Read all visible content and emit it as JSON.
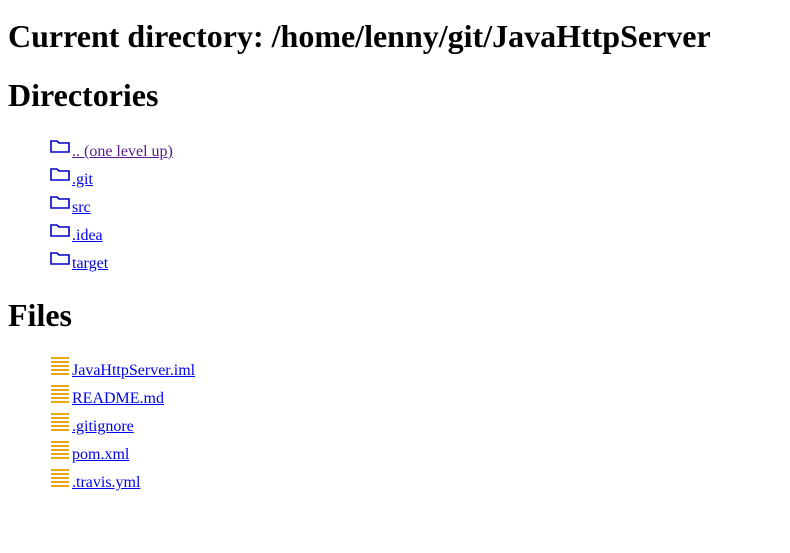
{
  "page": {
    "title": "Current directory: /home/lenny/git/JavaHttpServer",
    "directories_heading": "Directories",
    "files_heading": "Files"
  },
  "directories": [
    {
      "label": ".. (one level up)",
      "visited": true,
      "icon": "folder-icon"
    },
    {
      "label": ".git",
      "visited": false,
      "icon": "folder-icon"
    },
    {
      "label": "src",
      "visited": false,
      "icon": "folder-icon"
    },
    {
      "label": ".idea",
      "visited": false,
      "icon": "folder-icon"
    },
    {
      "label": "target",
      "visited": false,
      "icon": "folder-icon"
    }
  ],
  "files": [
    {
      "label": "JavaHttpServer.iml",
      "icon": "file-icon"
    },
    {
      "label": "README.md",
      "icon": "file-icon"
    },
    {
      "label": ".gitignore",
      "icon": "file-icon"
    },
    {
      "label": "pom.xml",
      "icon": "file-icon"
    },
    {
      "label": ".travis.yml",
      "icon": "file-icon"
    }
  ],
  "colors": {
    "link": "#0000ee",
    "visited_link": "#551a8b",
    "folder_icon": "#0000cc",
    "file_icon": "#e6a817"
  }
}
